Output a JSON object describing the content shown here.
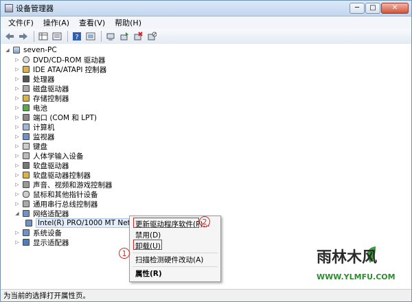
{
  "window": {
    "title": "设备管理器",
    "controls": [
      "─",
      "□",
      "✕"
    ]
  },
  "menubar": [
    "文件(F)",
    "操作(A)",
    "查看(V)",
    "帮助(H)"
  ],
  "toolbar_icons": [
    "back-arrow-icon",
    "forward-arrow-icon",
    "properties-grid-icon",
    "list-view-icon",
    "help-icon",
    "resource-view-icon",
    "scan-hardware-icon",
    "update-driver-icon",
    "uninstall-icon",
    "disable-icon"
  ],
  "tree": {
    "root": "seven-PC",
    "items": [
      "DVD/CD-ROM 驱动器",
      "IDE ATA/ATAPI 控制器",
      "处理器",
      "磁盘驱动器",
      "存储控制器",
      "电池",
      "端口 (COM 和 LPT)",
      "计算机",
      "监视器",
      "键盘",
      "人体学输入设备",
      "软盘驱动器",
      "软盘驱动器控制器",
      "声音、视频和游戏控制器",
      "鼠标和其他指针设备",
      "通用串行总线控制器",
      "网络适配器"
    ],
    "child": "Intel(R) PRO/1000 MT Netw",
    "after_items": [
      "系统设备",
      "显示适配器"
    ]
  },
  "context_menu": {
    "update": "更新驱动程序软件(P)...",
    "disable": "禁用(D)",
    "uninstall": "卸载(U)",
    "scan": "扫描检测硬件改动(A)",
    "properties": "属性(R)"
  },
  "annotations": {
    "one": "1",
    "two": "2"
  },
  "statusbar": "为当前的选择打开属性页。",
  "watermark": {
    "main": "雨林木风",
    "sub": "WWW.YLMFU.COM"
  },
  "colors": {
    "annotation_red": "#e02020",
    "selection": "#e4eefb"
  }
}
